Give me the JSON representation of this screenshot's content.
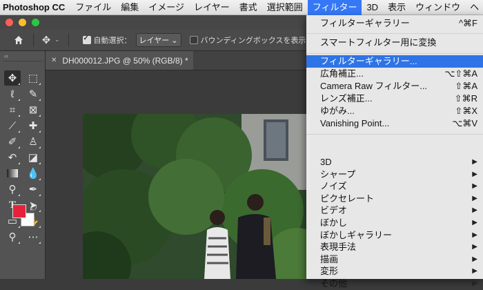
{
  "menubar": {
    "app_name": "Photoshop CC",
    "items": [
      "ファイル",
      "編集",
      "イメージ",
      "レイヤー",
      "書式",
      "選択範囲",
      "フィルター",
      "3D",
      "表示",
      "ウィンドウ",
      "ヘ"
    ],
    "active_item": "フィルター"
  },
  "options_bar": {
    "auto_select_label": "自動選択：",
    "auto_select_checked": true,
    "auto_select_target": "レイヤー",
    "bounding_box_label": "バウンディングボックスを表示",
    "bounding_box_checked": false
  },
  "document": {
    "tab_title": "DH000012.JPG @ 50% (RGB/8) *"
  },
  "colors": {
    "foreground": "#e8213a",
    "background": "#ffffff",
    "menu_highlight": "#2e74e6",
    "menubar_active": "#3478f6"
  },
  "filter_menu": {
    "last_filter": {
      "label": "フィルターギャラリー",
      "shortcut": "^⌘F"
    },
    "convert_smart": {
      "label": "スマートフィルター用に変換"
    },
    "group2": [
      {
        "label": "フィルターギャラリー...",
        "shortcut": ""
      },
      {
        "label": "広角補正...",
        "shortcut": "⌥⇧⌘A"
      },
      {
        "label": "Camera Raw フィルター...",
        "shortcut": "⇧⌘A"
      },
      {
        "label": "レンズ補正...",
        "shortcut": "⇧⌘R"
      },
      {
        "label": "ゆがみ...",
        "shortcut": "⇧⌘X"
      },
      {
        "label": "Vanishing Point...",
        "shortcut": "⌥⌘V"
      }
    ],
    "submenus": [
      "3D",
      "シャープ",
      "ノイズ",
      "ピクセレート",
      "ビデオ",
      "ぼかし",
      "ぼかしギャラリー",
      "表現手法",
      "描画",
      "変形",
      "その他"
    ],
    "highlighted": "フィルターギャラリー..."
  },
  "tools": {
    "icons": [
      "move-icon",
      "marquee-icon",
      "lasso-icon",
      "quick-select-icon",
      "crop-icon",
      "frame-icon",
      "eyedropper-icon",
      "healing-brush-icon",
      "brush-icon",
      "clone-stamp-icon",
      "history-brush-icon",
      "eraser-icon",
      "gradient-icon",
      "blur-icon",
      "dodge-icon",
      "pen-icon",
      "type-icon",
      "path-select-icon",
      "rectangle-icon",
      "hand-icon",
      "zoom-icon",
      "more-icon"
    ]
  }
}
